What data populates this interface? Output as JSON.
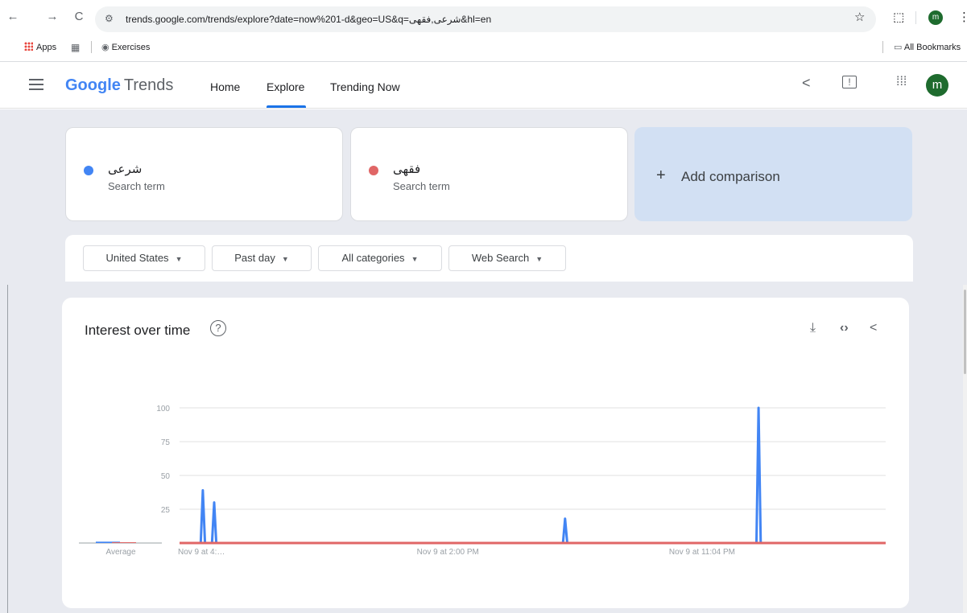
{
  "browser": {
    "nav": {
      "back": "←",
      "forward": "→",
      "reload": "C"
    },
    "site_icon": "tune-icon",
    "url": "trends.google.com/trends/explore?date=now%201-d&geo=US&q=شرعی,فقهی&hl=en",
    "avatar_letter": "m",
    "bookmarks": {
      "apps": "Apps",
      "exercises": "Exercises",
      "all_bookmarks": "All Bookmarks"
    }
  },
  "header": {
    "logo_google": "Google",
    "logo_trends": "Trends",
    "nav": {
      "home": "Home",
      "explore": "Explore",
      "trending": "Trending Now"
    },
    "avatar_letter": "m"
  },
  "terms": [
    {
      "name": "شرعی",
      "sub": "Search term",
      "color": "#4285f4"
    },
    {
      "name": "فقهی",
      "sub": "Search term",
      "color": "#e06666"
    }
  ],
  "add_comparison": {
    "plus": "+",
    "label": "Add comparison"
  },
  "filters": {
    "region": "United States",
    "time": "Past day",
    "category": "All categories",
    "search_type": "Web Search"
  },
  "interest_card": {
    "title": "Interest over time",
    "help": "?"
  },
  "chart_data": {
    "type": "line",
    "title": "Interest over time",
    "ylim": [
      0,
      100
    ],
    "y_ticks": [
      "100",
      "75",
      "50",
      "25"
    ],
    "x_labels": [
      "Nov 9 at 4:…",
      "Nov 9 at 2:00 PM",
      "Nov 9 at 11:04 PM"
    ],
    "average_label": "Average",
    "grid": true,
    "series": [
      {
        "name": "شرعی",
        "color": "#4285f4",
        "average": 1,
        "points": [
          [
            0,
            0
          ],
          [
            0.03,
            0
          ],
          [
            0.033,
            39
          ],
          [
            0.036,
            0
          ],
          [
            0.046,
            0
          ],
          [
            0.049,
            30
          ],
          [
            0.052,
            0
          ],
          [
            0.543,
            0
          ],
          [
            0.546,
            18
          ],
          [
            0.549,
            0
          ],
          [
            0.817,
            0
          ],
          [
            0.82,
            100
          ],
          [
            0.823,
            0
          ],
          [
            1,
            0
          ]
        ]
      },
      {
        "name": "فقهی",
        "color": "#e06666",
        "average": 0,
        "points": [
          [
            0,
            0
          ],
          [
            1,
            0
          ]
        ]
      }
    ]
  }
}
